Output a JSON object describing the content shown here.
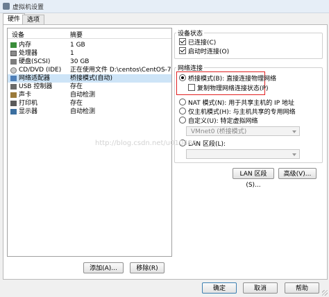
{
  "window": {
    "title": "虚拟机设置"
  },
  "tabs": [
    {
      "label": "硬件"
    },
    {
      "label": "选项"
    }
  ],
  "device_list": {
    "header_device": "设备",
    "header_summary": "摘要",
    "rows": [
      {
        "name": "内存",
        "summary": "1 GB",
        "icon": "memory-icon"
      },
      {
        "name": "处理器",
        "summary": "1",
        "icon": "processor-icon"
      },
      {
        "name": "硬盘(SCSI)",
        "summary": "30 GB",
        "icon": "harddisk-icon"
      },
      {
        "name": "CD/DVD (IDE)",
        "summary": "正在使用文件 D:\\centos\\CentOS-7-...",
        "icon": "cd-icon"
      },
      {
        "name": "网络适配器",
        "summary": "桥接模式(自动)",
        "icon": "network-icon"
      },
      {
        "name": "USB 控制器",
        "summary": "存在",
        "icon": "usb-icon"
      },
      {
        "name": "声卡",
        "summary": "自动检测",
        "icon": "sound-icon"
      },
      {
        "name": "打印机",
        "summary": "存在",
        "icon": "printer-icon"
      },
      {
        "name": "显示器",
        "summary": "自动检测",
        "icon": "display-icon"
      }
    ],
    "selected_index": 4,
    "add_button": "添加(A)...",
    "remove_button": "移除(R)"
  },
  "device_status": {
    "legend": "设备状态",
    "connected_label": "已连接(C)",
    "connected": true,
    "power_on_connect_label": "启动时连接(O)",
    "power_on_connect": true
  },
  "network_connection": {
    "legend": "网络连接",
    "bridged_label": "桥接模式(B): 直接连接物理网络",
    "bridged": true,
    "replicate_label": "复制物理网络连接状态(P)",
    "replicate": false,
    "nat_label": "NAT 模式(N): 用于共享主机的 IP 地址",
    "hostonly_label": "仅主机模式(H): 与主机共享的专用网络",
    "custom_label": "自定义(U): 特定虚拟网络",
    "custom_select_value": "VMnet0 (桥接模式)",
    "lan_label": "LAN 区段(L):",
    "lan_select_value": "",
    "lan_segments_button": "LAN 区段(S)...",
    "advanced_button": "高级(V)..."
  },
  "footer": {
    "ok": "确定",
    "cancel": "取消",
    "help": "帮助"
  },
  "watermark": "http://blog.csdn.net/u010488"
}
